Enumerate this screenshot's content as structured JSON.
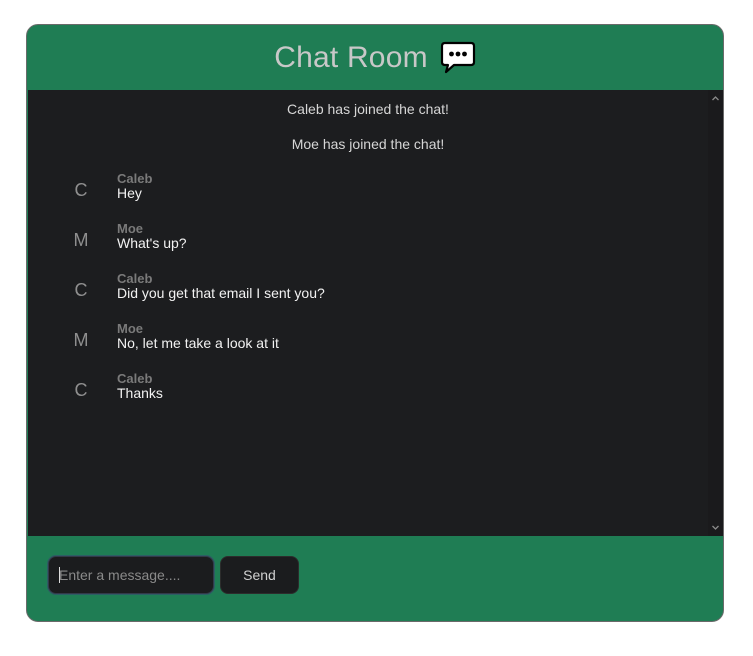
{
  "header": {
    "title": "Chat Room",
    "icon": "speech-bubble-icon"
  },
  "system_messages": [
    "Caleb has joined the chat!",
    "Moe has joined the chat!"
  ],
  "messages": [
    {
      "avatar": "C",
      "sender": "Caleb",
      "text": "Hey"
    },
    {
      "avatar": "M",
      "sender": "Moe",
      "text": "What's up?"
    },
    {
      "avatar": "C",
      "sender": "Caleb",
      "text": "Did you get that email I sent you?"
    },
    {
      "avatar": "M",
      "sender": "Moe",
      "text": "No, let me take a look at it"
    },
    {
      "avatar": "C",
      "sender": "Caleb",
      "text": "Thanks"
    }
  ],
  "composer": {
    "placeholder": "Enter a message....",
    "value": "",
    "send_label": "Send"
  },
  "colors": {
    "accent": "#1f7d54",
    "panel": "#1c1d1f",
    "title_text": "#c8c8c8"
  }
}
